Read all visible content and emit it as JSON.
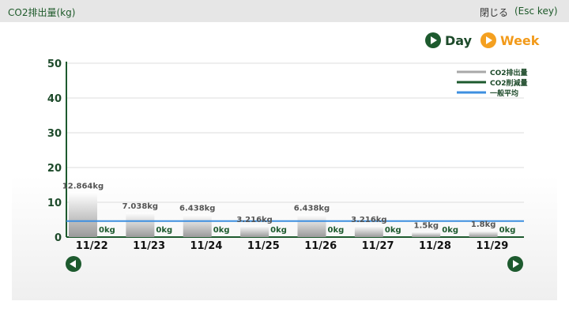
{
  "header": {
    "title": "CO2排出量(kg)",
    "close_label": "閉じる",
    "esc_label": "(Esc key)"
  },
  "toggle": {
    "day_label": "Day",
    "week_label": "Week"
  },
  "colors": {
    "emission": "#a8a8a8",
    "reduction": "#1d5a2e",
    "average": "#3d8fe0",
    "axis": "#1d5a2e",
    "week": "#f4a020"
  },
  "chart_data": {
    "type": "bar",
    "categories": [
      "11/22",
      "11/23",
      "11/24",
      "11/25",
      "11/26",
      "11/27",
      "11/28",
      "11/29"
    ],
    "series": [
      {
        "name": "CO2排出量",
        "values": [
          12.864,
          7.038,
          6.438,
          3.216,
          6.438,
          3.216,
          1.5,
          1.8
        ],
        "labels": [
          "12.864kg",
          "7.038kg",
          "6.438kg",
          "3.216kg",
          "6.438kg",
          "3.216kg",
          "1.5kg",
          "1.8kg"
        ]
      },
      {
        "name": "CO2削減量",
        "values": [
          0,
          0,
          0,
          0,
          0,
          0,
          0,
          0
        ],
        "labels": [
          "0kg",
          "0kg",
          "0kg",
          "0kg",
          "0kg",
          "0kg",
          "0kg",
          "0kg"
        ]
      },
      {
        "name": "一般平均",
        "type": "line",
        "value": 4.6
      }
    ],
    "ylim": [
      0,
      50
    ],
    "yticks": [
      0,
      10,
      20,
      30,
      40,
      50
    ],
    "grid": true,
    "legend": "top-right"
  }
}
